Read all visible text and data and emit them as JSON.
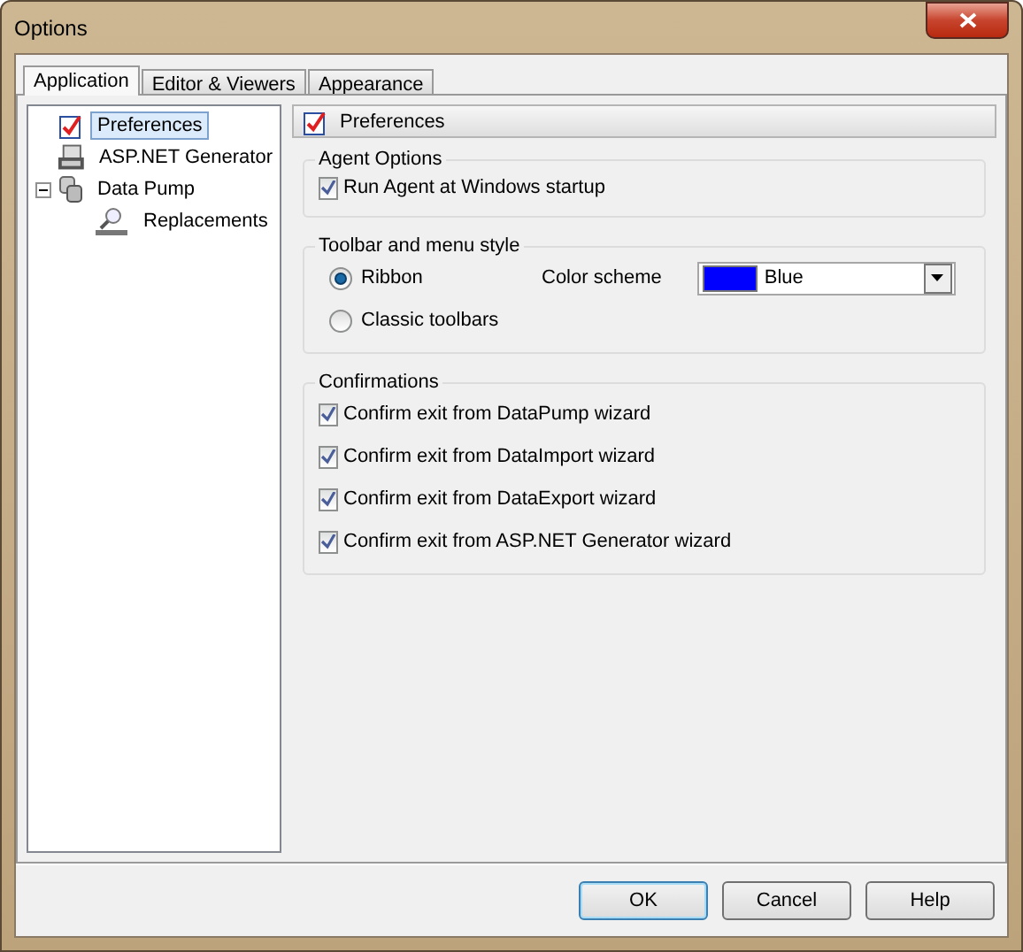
{
  "window": {
    "title": "Options"
  },
  "tabs": [
    {
      "label": "Application",
      "selected": true
    },
    {
      "label": "Editor & Viewers",
      "selected": false
    },
    {
      "label": "Appearance",
      "selected": false
    }
  ],
  "tree": [
    {
      "label": "Preferences",
      "kind": "check",
      "selected": true
    },
    {
      "label": "ASP.NET Generator",
      "kind": "asp",
      "selected": false
    },
    {
      "label": "Data Pump",
      "kind": "pump",
      "selected": false,
      "expanded": true,
      "children": [
        {
          "label": "Replacements",
          "kind": "find",
          "selected": false
        }
      ]
    }
  ],
  "page_header": {
    "title": "Preferences"
  },
  "groups": [
    {
      "title": "Agent Options",
      "items": [
        {
          "kind": "checkbox",
          "label": "Run Agent at Windows startup",
          "checked": true
        }
      ]
    },
    {
      "title": "Toolbar and menu style",
      "items": [
        {
          "kind": "radio",
          "label": "Ribbon",
          "selected": true
        },
        {
          "kind": "radio",
          "label": "Classic toolbars",
          "selected": false
        }
      ],
      "combo": {
        "label": "Color scheme",
        "value": "Blue"
      }
    },
    {
      "title": "Confirmations",
      "items": [
        {
          "kind": "checkbox",
          "label": "Confirm exit from DataPump wizard",
          "checked": true
        },
        {
          "kind": "checkbox",
          "label": "Confirm exit from DataImport wizard",
          "checked": true
        },
        {
          "kind": "checkbox",
          "label": "Confirm exit from DataExport wizard",
          "checked": true
        },
        {
          "kind": "checkbox",
          "label": "Confirm exit from ASP.NET Generator wizard",
          "checked": true
        }
      ]
    }
  ],
  "buttons": [
    {
      "label": "OK",
      "default": true
    },
    {
      "label": "Cancel",
      "default": false
    },
    {
      "label": "Help",
      "default": false
    }
  ]
}
